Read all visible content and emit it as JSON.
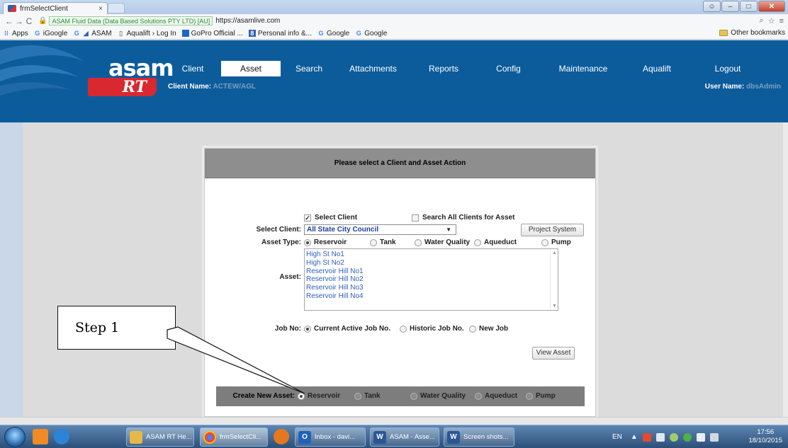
{
  "browser": {
    "tab_title": "frmSelectClient",
    "tab_close": "×",
    "cert": "ASAM Fluid Data (Data Based Solutions PTY LTD) [AU]",
    "url": "https://asamlive.com",
    "bookmarks": [
      "Apps",
      "iGoogle",
      "ASAM",
      "Aqualift › Log In",
      "GoPro Official ...",
      "Personal info &...",
      "Google",
      "Google"
    ],
    "other_bookmarks": "Other bookmarks"
  },
  "app": {
    "logo_text": "asam",
    "logo_sub": "RT",
    "menu": [
      "Client",
      "Asset",
      "Search",
      "Attachments",
      "Reports",
      "Config",
      "Maintenance",
      "Aqualift",
      "Logout"
    ],
    "active_menu": "Asset",
    "client_name_label": "Client Name:",
    "client_name_value": "ACTEW/AGL",
    "user_name_label": "User Name:",
    "user_name_value": "dbsAdmin"
  },
  "panel": {
    "title": "Please select a Client and Asset Action",
    "select_client_check": "Select Client",
    "search_all_check": "Search All Clients for Asset",
    "select_client_label": "Select Client:",
    "select_client_value": "All State City Council",
    "project_system_button": "Project System",
    "asset_type_label": "Asset Type:",
    "asset_types": [
      "Reservoir",
      "Tank",
      "Water Quality",
      "Aqueduct",
      "Pump"
    ],
    "asset_label": "Asset:",
    "assets": [
      "High St No1",
      "High St No2",
      "Reservoir Hill No1",
      "Reservoir Hill No2",
      "Reservoir Hill No3",
      "Reservoir Hill No4"
    ],
    "job_no_label": "Job No:",
    "job_options": [
      "Current Active Job No.",
      "Historic Job No.",
      "New Job"
    ],
    "view_asset_button": "View Asset",
    "create_new_label": "Create New Asset:",
    "create_options": [
      "Reservoir",
      "Tank",
      "Water Quality",
      "Aqueduct",
      "Pump"
    ]
  },
  "callout": {
    "text": "Step 1"
  },
  "taskbar": {
    "items": [
      "ASAM RT He...",
      "frmSelectCli...",
      "Inbox - davi...",
      "ASAM - Asse...",
      "Screen shots..."
    ],
    "lang": "EN",
    "time": "17:56",
    "date": "18/10/2015"
  }
}
